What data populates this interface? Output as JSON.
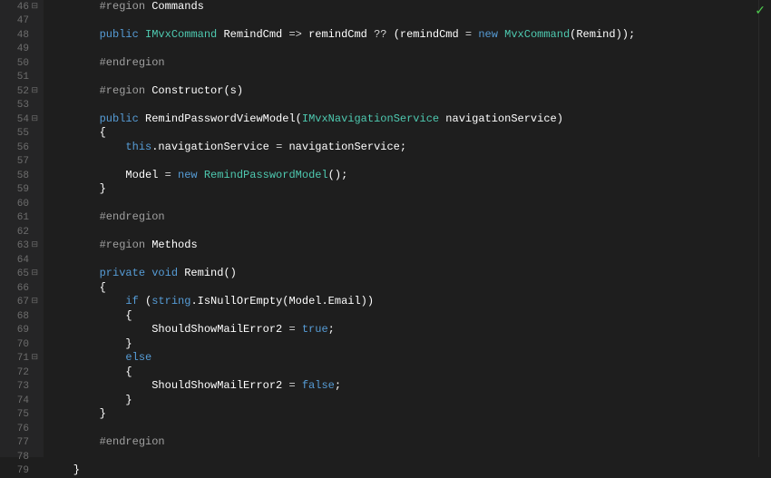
{
  "status": {
    "checkmark": "✓"
  },
  "lines": [
    {
      "num": "46",
      "fold": "⊟",
      "segments": [
        {
          "txt": "        ",
          "cls": ""
        },
        {
          "txt": "#region",
          "cls": "rgn"
        },
        {
          "txt": " Commands",
          "cls": "white"
        }
      ]
    },
    {
      "num": "47",
      "fold": "",
      "segments": []
    },
    {
      "num": "48",
      "fold": "",
      "segments": [
        {
          "txt": "        ",
          "cls": ""
        },
        {
          "txt": "public ",
          "cls": "kw"
        },
        {
          "txt": "IMvxCommand",
          "cls": "typ"
        },
        {
          "txt": " RemindCmd ",
          "cls": "white"
        },
        {
          "txt": "=>",
          "cls": "op"
        },
        {
          "txt": " remindCmd ",
          "cls": "white"
        },
        {
          "txt": "??",
          "cls": "op"
        },
        {
          "txt": " (remindCmd ",
          "cls": "white"
        },
        {
          "txt": "=",
          "cls": "op"
        },
        {
          "txt": " ",
          "cls": ""
        },
        {
          "txt": "new ",
          "cls": "kw"
        },
        {
          "txt": "MvxCommand",
          "cls": "typ"
        },
        {
          "txt": "(Remind));",
          "cls": "white"
        }
      ]
    },
    {
      "num": "49",
      "fold": "",
      "segments": []
    },
    {
      "num": "50",
      "fold": "",
      "segments": [
        {
          "txt": "        ",
          "cls": ""
        },
        {
          "txt": "#endregion",
          "cls": "rgn"
        }
      ]
    },
    {
      "num": "51",
      "fold": "",
      "segments": []
    },
    {
      "num": "52",
      "fold": "⊟",
      "segments": [
        {
          "txt": "        ",
          "cls": ""
        },
        {
          "txt": "#region",
          "cls": "rgn"
        },
        {
          "txt": " Constructor(s)",
          "cls": "white"
        }
      ]
    },
    {
      "num": "53",
      "fold": "",
      "segments": []
    },
    {
      "num": "54",
      "fold": "⊟",
      "segments": [
        {
          "txt": "        ",
          "cls": ""
        },
        {
          "txt": "public ",
          "cls": "kw"
        },
        {
          "txt": "RemindPasswordViewModel",
          "cls": "white"
        },
        {
          "txt": "(",
          "cls": "white"
        },
        {
          "txt": "IMvxNavigationService",
          "cls": "typ"
        },
        {
          "txt": " navigationService)",
          "cls": "white"
        }
      ]
    },
    {
      "num": "55",
      "fold": "",
      "segments": [
        {
          "txt": "        {",
          "cls": "white"
        }
      ]
    },
    {
      "num": "56",
      "fold": "",
      "segments": [
        {
          "txt": "            ",
          "cls": ""
        },
        {
          "txt": "this",
          "cls": "kw"
        },
        {
          "txt": ".navigationService ",
          "cls": "white"
        },
        {
          "txt": "=",
          "cls": "op"
        },
        {
          "txt": " navigationService;",
          "cls": "white"
        }
      ]
    },
    {
      "num": "57",
      "fold": "",
      "segments": []
    },
    {
      "num": "58",
      "fold": "",
      "segments": [
        {
          "txt": "            Model ",
          "cls": "white"
        },
        {
          "txt": "=",
          "cls": "op"
        },
        {
          "txt": " ",
          "cls": ""
        },
        {
          "txt": "new ",
          "cls": "kw"
        },
        {
          "txt": "RemindPasswordModel",
          "cls": "typ"
        },
        {
          "txt": "();",
          "cls": "white"
        }
      ]
    },
    {
      "num": "59",
      "fold": "",
      "segments": [
        {
          "txt": "        }",
          "cls": "white"
        }
      ]
    },
    {
      "num": "60",
      "fold": "",
      "segments": []
    },
    {
      "num": "61",
      "fold": "",
      "segments": [
        {
          "txt": "        ",
          "cls": ""
        },
        {
          "txt": "#endregion",
          "cls": "rgn"
        }
      ]
    },
    {
      "num": "62",
      "fold": "",
      "segments": []
    },
    {
      "num": "63",
      "fold": "⊟",
      "segments": [
        {
          "txt": "        ",
          "cls": ""
        },
        {
          "txt": "#region",
          "cls": "rgn"
        },
        {
          "txt": " Methods",
          "cls": "white"
        }
      ]
    },
    {
      "num": "64",
      "fold": "",
      "segments": []
    },
    {
      "num": "65",
      "fold": "⊟",
      "segments": [
        {
          "txt": "        ",
          "cls": ""
        },
        {
          "txt": "private ",
          "cls": "kw"
        },
        {
          "txt": "void ",
          "cls": "kw"
        },
        {
          "txt": "Remind",
          "cls": "white"
        },
        {
          "txt": "()",
          "cls": "white"
        }
      ]
    },
    {
      "num": "66",
      "fold": "",
      "segments": [
        {
          "txt": "        {",
          "cls": "white"
        }
      ]
    },
    {
      "num": "67",
      "fold": "⊟",
      "segments": [
        {
          "txt": "            ",
          "cls": ""
        },
        {
          "txt": "if ",
          "cls": "kw"
        },
        {
          "txt": "(",
          "cls": "white"
        },
        {
          "txt": "string",
          "cls": "kw"
        },
        {
          "txt": ".IsNullOrEmpty(Model.Email))",
          "cls": "white"
        }
      ]
    },
    {
      "num": "68",
      "fold": "",
      "segments": [
        {
          "txt": "            {",
          "cls": "white"
        }
      ]
    },
    {
      "num": "69",
      "fold": "",
      "segments": [
        {
          "txt": "                ShouldShowMailError2 ",
          "cls": "white"
        },
        {
          "txt": "=",
          "cls": "op"
        },
        {
          "txt": " ",
          "cls": ""
        },
        {
          "txt": "true",
          "cls": "kw"
        },
        {
          "txt": ";",
          "cls": "white"
        }
      ]
    },
    {
      "num": "70",
      "fold": "",
      "segments": [
        {
          "txt": "            }",
          "cls": "white"
        }
      ]
    },
    {
      "num": "71",
      "fold": "⊟",
      "segments": [
        {
          "txt": "            ",
          "cls": ""
        },
        {
          "txt": "else",
          "cls": "kw"
        }
      ]
    },
    {
      "num": "72",
      "fold": "",
      "segments": [
        {
          "txt": "            {",
          "cls": "white"
        }
      ]
    },
    {
      "num": "73",
      "fold": "",
      "segments": [
        {
          "txt": "                ShouldShowMailError2 ",
          "cls": "white"
        },
        {
          "txt": "=",
          "cls": "op"
        },
        {
          "txt": " ",
          "cls": ""
        },
        {
          "txt": "false",
          "cls": "kw"
        },
        {
          "txt": ";",
          "cls": "white"
        }
      ]
    },
    {
      "num": "74",
      "fold": "",
      "segments": [
        {
          "txt": "            }",
          "cls": "white"
        }
      ]
    },
    {
      "num": "75",
      "fold": "",
      "segments": [
        {
          "txt": "        }",
          "cls": "white"
        }
      ]
    },
    {
      "num": "76",
      "fold": "",
      "segments": []
    },
    {
      "num": "77",
      "fold": "",
      "segments": [
        {
          "txt": "        ",
          "cls": ""
        },
        {
          "txt": "#endregion",
          "cls": "rgn"
        }
      ]
    },
    {
      "num": "78",
      "fold": "",
      "segments": []
    },
    {
      "num": "79",
      "fold": "",
      "segments": [
        {
          "txt": "    }",
          "cls": "white"
        }
      ]
    }
  ]
}
